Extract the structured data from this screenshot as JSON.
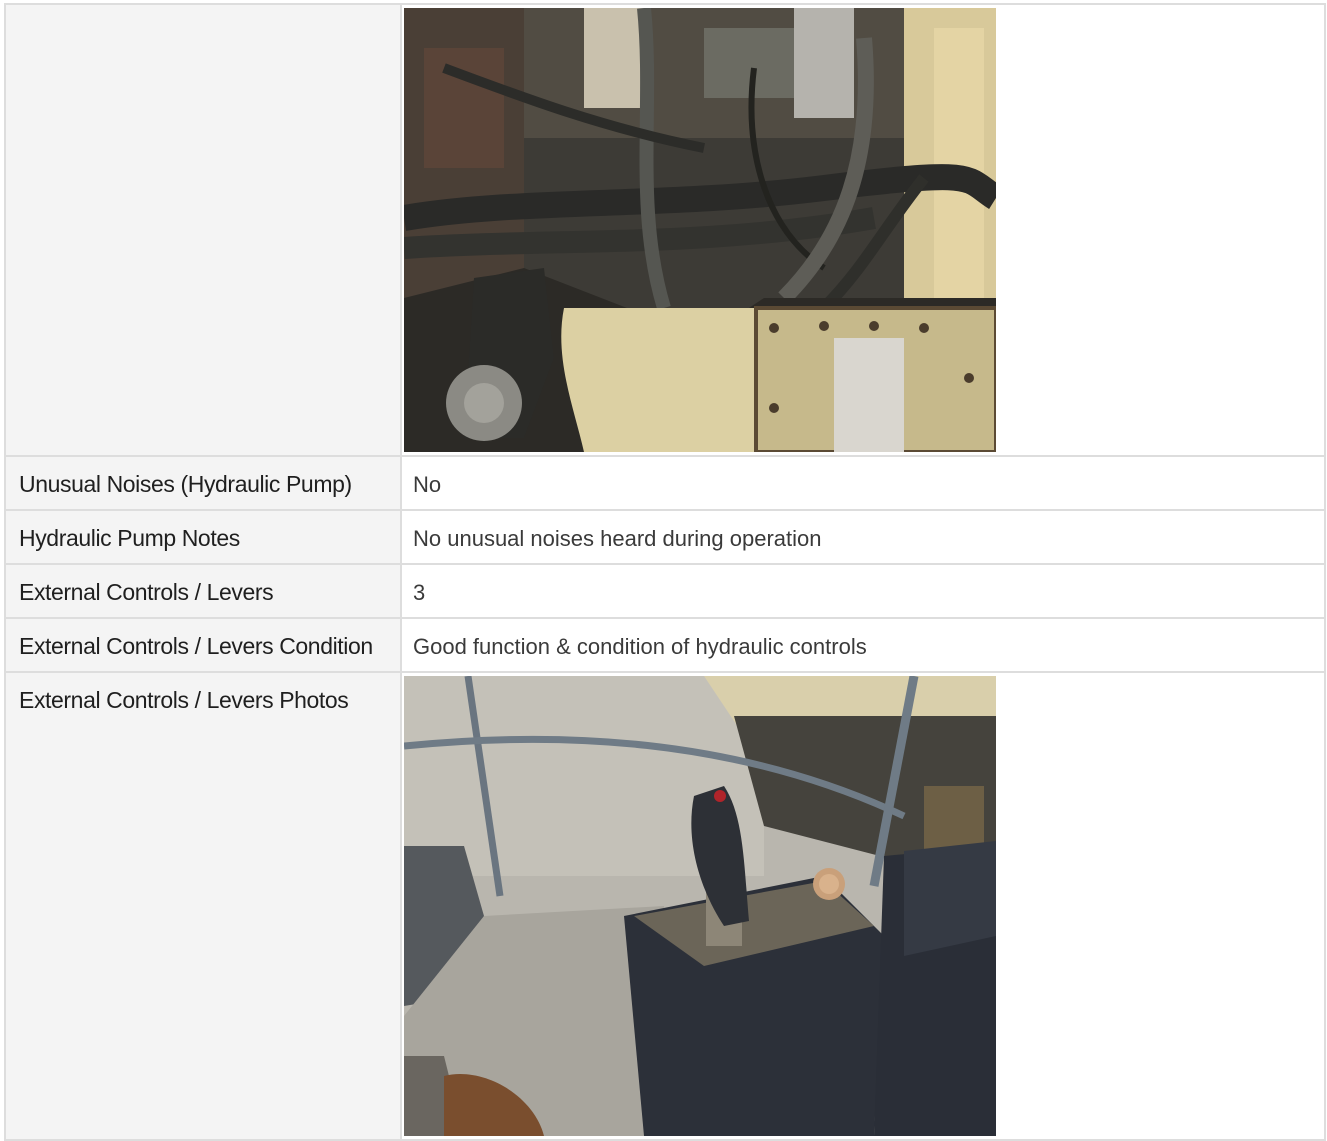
{
  "rows": [
    {
      "label": "",
      "type": "photo",
      "photo_name": "hydraulic-pump-photo"
    },
    {
      "label": "Unusual Noises (Hydraulic Pump)",
      "value": "No"
    },
    {
      "label": "Hydraulic Pump Notes",
      "value": "No unusual noises heard during operation"
    },
    {
      "label": "External Controls / Levers",
      "value": "3"
    },
    {
      "label": "External Controls / Levers Condition",
      "value": "Good function & condition of hydraulic controls"
    },
    {
      "label": "External Controls / Levers Photos",
      "type": "photo",
      "photo_name": "external-controls-photo"
    }
  ]
}
